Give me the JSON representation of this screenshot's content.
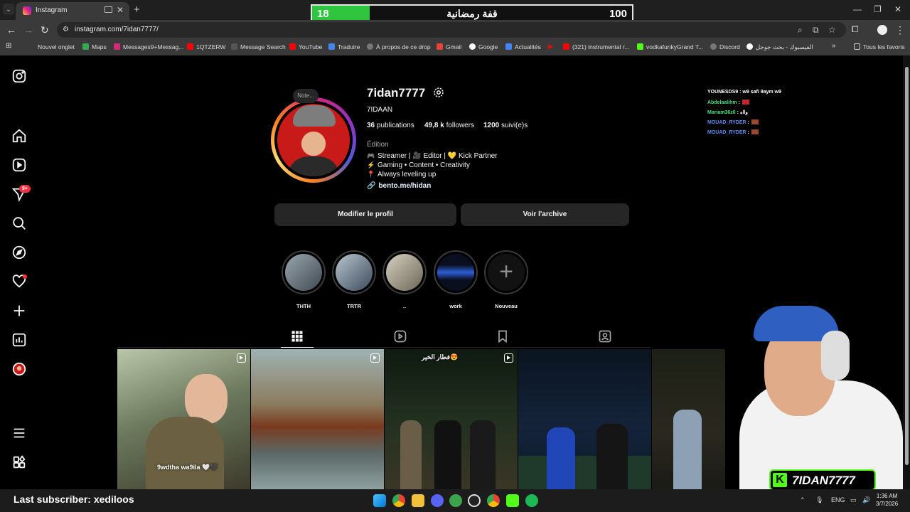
{
  "browser": {
    "tab_title": "Instagram",
    "url": "instagram.com/7idan7777/",
    "bookmarks": [
      "Nouvel onglet",
      "Maps",
      "Messages9+Messag...",
      "1QTZERW",
      "Message Search",
      "YouTube",
      "Traduire",
      "À propos de ce drop",
      "Gmail",
      "Google",
      "Actualités",
      "(321) instrumental r...",
      "vodkafunkyGrand T...",
      "Discord",
      "الفيسبوك - بحث جوجل",
      "Tous les favoris"
    ]
  },
  "overlay": {
    "goal_current": "18",
    "goal_title": "قفة رمضانية",
    "goal_target": "100",
    "goal_progress": 0.18,
    "last_subscriber": "Last subscriber: xediloos",
    "channel_name": "7IDAN7777",
    "chat": [
      {
        "user": "YOUNESDS9",
        "msg": ": w9 safi 9aym w9",
        "color": "#ffffff"
      },
      {
        "user": "Abdelaalihm",
        "msg": ":",
        "color": "#4ade80"
      },
      {
        "user": "Mariam36z6",
        "msg": ": وااه",
        "color": "#4ade80"
      },
      {
        "user": "MOUAD_RYDER",
        "msg": ":",
        "color": "#5b8def"
      },
      {
        "user": "MOUAD_RYDER",
        "msg": ":",
        "color": "#5b8def"
      }
    ]
  },
  "profile": {
    "note": "Note...",
    "username": "7idan7777",
    "full_name": "7IDAAN",
    "posts_count": "36",
    "posts_label": "publications",
    "followers_count": "49,8 k",
    "followers_label": "followers",
    "following_count": "1200",
    "following_label": "suivi(e)s",
    "category": "Édition",
    "bio": [
      {
        "emoji": "🎮",
        "text": "Streamer | 🎥 Editor | 💛 Kick Partner"
      },
      {
        "emoji": "⚡",
        "text": "Gaming • Content • Creativity"
      },
      {
        "emoji": "📍",
        "text": "Always leveling up"
      }
    ],
    "link": "bento.me/hidan",
    "edit_button": "Modifier le profil",
    "archive_button": "Voir l'archive"
  },
  "highlights": [
    {
      "label": "THTH",
      "color": "#6d7b83"
    },
    {
      "label": "TRTR",
      "color": "#5a6a7a"
    },
    {
      "label": "..",
      "color": "#8a8475"
    },
    {
      "label": "work",
      "color": "#1a2a55"
    },
    {
      "label": "Nouveau",
      "color": "#121212"
    }
  ],
  "posts": [
    {
      "caption": "9wdtha wa9ila 🤍🖤",
      "colors": [
        "#9fb08c",
        "#4b5540"
      ]
    },
    {
      "caption": "",
      "colors": [
        "#8aa0a0",
        "#6c3a22"
      ]
    },
    {
      "caption": "فطار الخير😍",
      "colors": [
        "#1b2a1a",
        "#3a3a2e"
      ]
    },
    {
      "caption": "",
      "colors": [
        "#0e1620",
        "#2a3f7a"
      ]
    },
    {
      "caption": "",
      "colors": [
        "#1a1d14",
        "#2c2a22"
      ]
    }
  ],
  "taskbar": {
    "lang": "ENG",
    "time": "1:36 AM",
    "date": "3/7/2026"
  }
}
